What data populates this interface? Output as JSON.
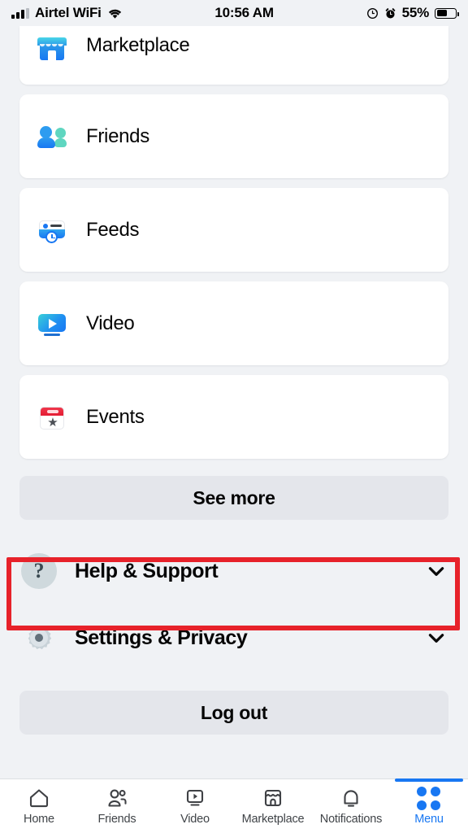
{
  "status_bar": {
    "carrier": "Airtel WiFi",
    "time": "10:56 AM",
    "battery_percent": "55%",
    "battery_level": 55,
    "icons": [
      "signal-icon",
      "wifi-icon",
      "rotation-lock-icon",
      "alarm-icon",
      "battery-icon"
    ]
  },
  "menu": {
    "shortcuts": [
      {
        "label": "Marketplace",
        "icon": "marketplace-icon"
      },
      {
        "label": "Friends",
        "icon": "friends-icon"
      },
      {
        "label": "Feeds",
        "icon": "feeds-icon"
      },
      {
        "label": "Video",
        "icon": "video-icon"
      },
      {
        "label": "Events",
        "icon": "events-icon"
      }
    ],
    "see_more_label": "See more",
    "expanders": [
      {
        "label": "Help & Support",
        "icon": "question-mark-icon",
        "chevron": "chevron-down-icon",
        "highlighted": true
      },
      {
        "label": "Settings & Privacy",
        "icon": "gear-icon",
        "chevron": "chevron-down-icon",
        "highlighted": false
      }
    ],
    "logout_label": "Log out"
  },
  "annotation": {
    "color": "#e7222a",
    "target": "Help & Support"
  },
  "tabbar": {
    "active": "Menu",
    "active_color": "#1877f2",
    "tabs": [
      {
        "label": "Home",
        "icon": "home-icon"
      },
      {
        "label": "Friends",
        "icon": "friends-outline-icon"
      },
      {
        "label": "Video",
        "icon": "video-outline-icon"
      },
      {
        "label": "Marketplace",
        "icon": "marketplace-outline-icon"
      },
      {
        "label": "Notifications",
        "icon": "bell-icon"
      },
      {
        "label": "Menu",
        "icon": "menu-grid-icon"
      }
    ]
  }
}
